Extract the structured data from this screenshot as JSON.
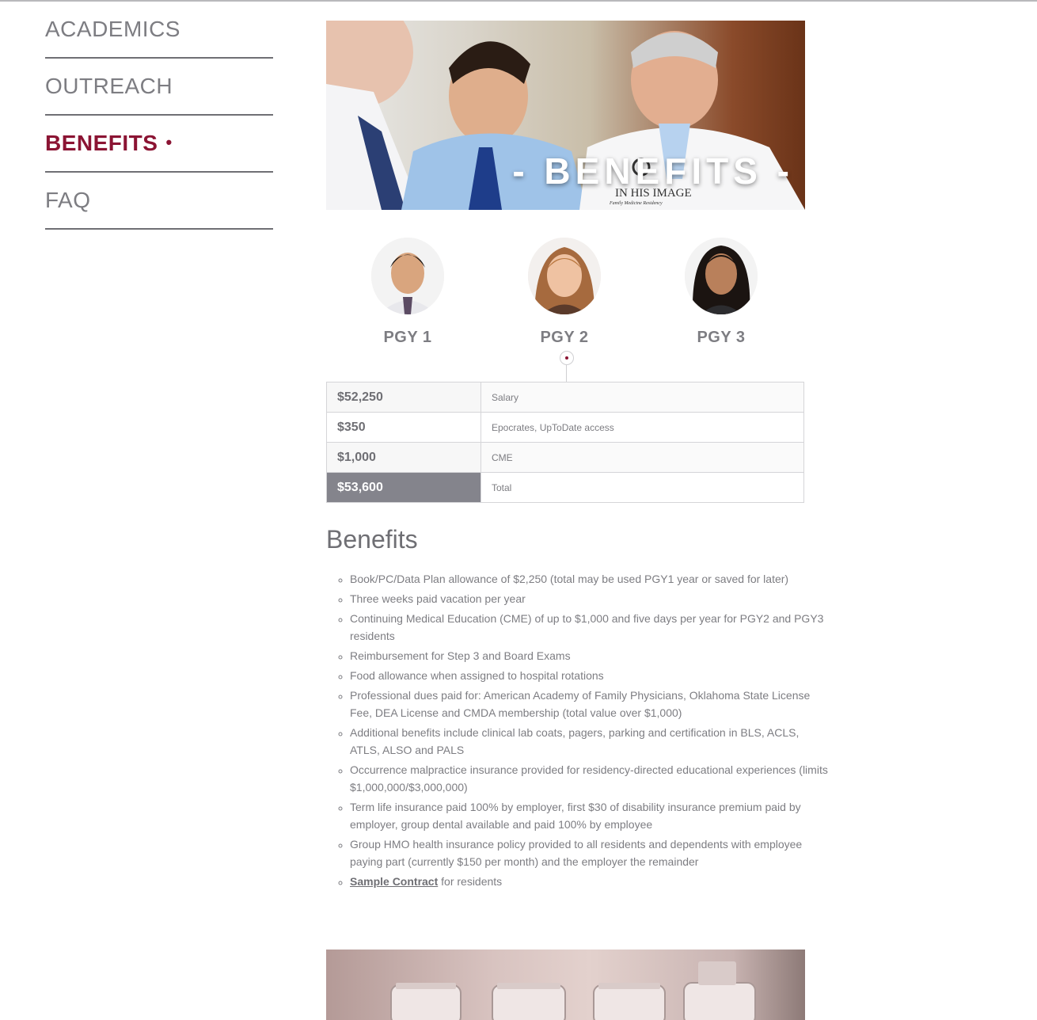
{
  "nav": {
    "items": [
      {
        "label": "ACADEMICS"
      },
      {
        "label": "OUTREACH"
      },
      {
        "label": "BENEFITS"
      },
      {
        "label": "FAQ"
      }
    ],
    "active_dot": "•"
  },
  "hero": {
    "title": "- BENEFITS -",
    "logo_text": "IN HIS IMAGE",
    "logo_subtext": "Family Medicine Residency"
  },
  "residents": [
    {
      "label": "PGY 1"
    },
    {
      "label": "PGY 2"
    },
    {
      "label": "PGY 3"
    }
  ],
  "salary_table": {
    "rows": [
      {
        "amount": "$52,250",
        "label": "Salary"
      },
      {
        "amount": "$350",
        "label": "Epocrates, UpToDate access"
      },
      {
        "amount": "$1,000",
        "label": "CME"
      },
      {
        "amount": "$53,600",
        "label": "Total"
      }
    ]
  },
  "benefits": {
    "title": "Benefits",
    "items": [
      "Book/PC/Data Plan allowance of $2,250 (total may be used PGY1 year or saved for later)",
      "Three weeks paid vacation per year",
      "Continuing Medical Education (CME) of up to $1,000 and five days per year for PGY2 and PGY3 residents",
      "Reimbursement for Step 3 and Board Exams",
      "Food allowance when assigned to hospital rotations",
      "Professional dues paid for: American Academy of Family Physicians, Oklahoma State License Fee, DEA License and CMDA membership (total value over $1,000)",
      "Additional benefits include clinical lab coats, pagers, parking and certification in BLS, ACLS, ATLS, ALSO and PALS",
      "Occurrence malpractice insurance provided for residency-directed educational experiences (limits $1,000,000/$3,000,000)",
      "Term life insurance paid 100% by employer, first $30 of disability insurance premium paid by employer, group dental available and paid 100% by employee",
      "Group HMO health insurance policy provided to all residents and dependents with employee paying part (currently $150 per month) and the employer the remainder"
    ],
    "contract_link": "Sample Contract",
    "contract_suffix": " for residents"
  },
  "colors": {
    "accent": "#8b1433",
    "text": "#6f6f74",
    "total_bg": "#84848c"
  }
}
